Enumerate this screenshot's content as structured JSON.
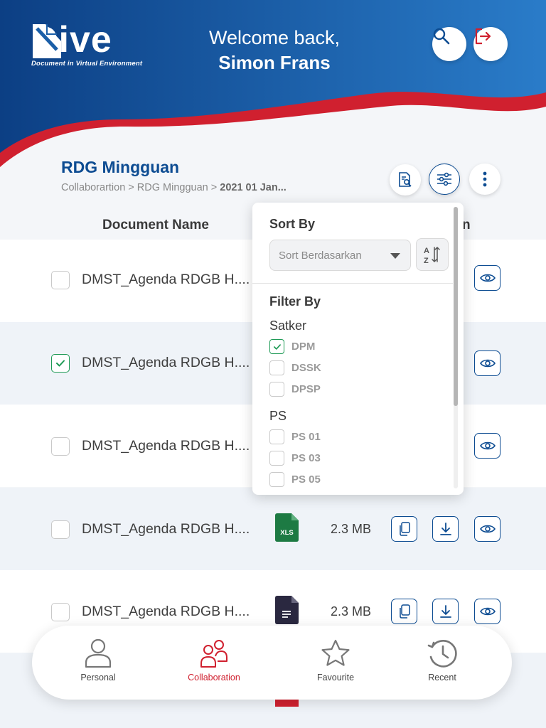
{
  "header": {
    "logo_word": "Dive",
    "logo_tagline": "Document in Virtual Environment",
    "welcome_line1": "Welcome back,",
    "welcome_name": "Simon Frans"
  },
  "folder": {
    "title": "RDG Mingguan",
    "breadcrumb_path": "Collaborartion > RDG Mingguan > ",
    "breadcrumb_current": "2021 01 Jan..."
  },
  "table": {
    "headers": {
      "name": "Document Name",
      "action": "n"
    },
    "rows": [
      {
        "name": "DMST_Agenda RDGB H....",
        "checked": false,
        "type": "",
        "size": ""
      },
      {
        "name": "DMST_Agenda RDGB H....",
        "checked": true,
        "type": "",
        "size": ""
      },
      {
        "name": "DMST_Agenda RDGB H....",
        "checked": false,
        "type": "",
        "size": ""
      },
      {
        "name": "DMST_Agenda RDGB H....",
        "checked": false,
        "type": "XLS",
        "size": "2.3 MB"
      },
      {
        "name": "DMST_Agenda RDGB H....",
        "checked": false,
        "type": "doc",
        "size": "2.3 MB"
      }
    ]
  },
  "sort_filter": {
    "sort_title": "Sort By",
    "sort_placeholder": "Sort Berdasarkan",
    "filter_title": "Filter By",
    "group1_title": "Satker",
    "group1_options": [
      {
        "label": "DPM",
        "checked": true
      },
      {
        "label": "DSSK",
        "checked": false
      },
      {
        "label": "DPSP",
        "checked": false
      }
    ],
    "group2_title": "PS",
    "group2_options": [
      {
        "label": "PS 01",
        "checked": false
      },
      {
        "label": "PS 03",
        "checked": false
      },
      {
        "label": "PS 05",
        "checked": false
      }
    ]
  },
  "nav": {
    "items": [
      {
        "label": "Personal",
        "icon": "person-icon",
        "active": false
      },
      {
        "label": "Collaboration",
        "icon": "group-icon",
        "active": true
      },
      {
        "label": "Favourite",
        "icon": "star-icon",
        "active": false
      },
      {
        "label": "Recent",
        "icon": "history-icon",
        "active": false
      }
    ]
  },
  "colors": {
    "brand_blue": "#0d4c92",
    "brand_red": "#d0202f",
    "check_green": "#1e9a55",
    "xls_green": "#1d7a43",
    "doc_dark": "#2a2840"
  }
}
